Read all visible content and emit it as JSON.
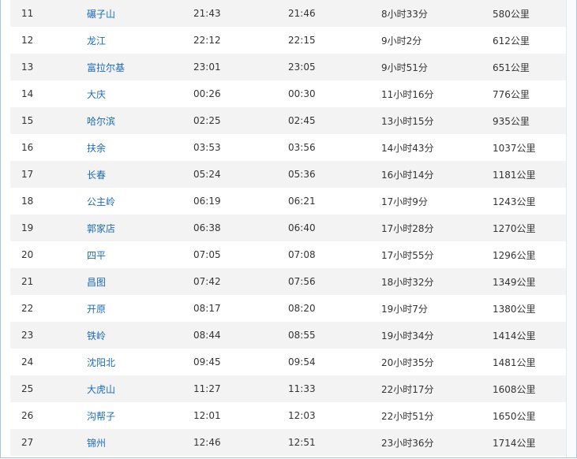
{
  "timetable": {
    "rows": [
      {
        "no": "11",
        "station": "碾子山",
        "arrive": "21:43",
        "depart": "21:46",
        "duration": "8小时33分",
        "distance": "580公里"
      },
      {
        "no": "12",
        "station": "龙江",
        "arrive": "22:12",
        "depart": "22:15",
        "duration": "9小时2分",
        "distance": "612公里"
      },
      {
        "no": "13",
        "station": "富拉尔基",
        "arrive": "23:01",
        "depart": "23:05",
        "duration": "9小时51分",
        "distance": "651公里"
      },
      {
        "no": "14",
        "station": "大庆",
        "arrive": "00:26",
        "depart": "00:30",
        "duration": "11小时16分",
        "distance": "776公里"
      },
      {
        "no": "15",
        "station": "哈尔滨",
        "arrive": "02:25",
        "depart": "02:45",
        "duration": "13小时15分",
        "distance": "935公里"
      },
      {
        "no": "16",
        "station": "扶余",
        "arrive": "03:53",
        "depart": "03:56",
        "duration": "14小时43分",
        "distance": "1037公里"
      },
      {
        "no": "17",
        "station": "长春",
        "arrive": "05:24",
        "depart": "05:36",
        "duration": "16小时14分",
        "distance": "1181公里"
      },
      {
        "no": "18",
        "station": "公主岭",
        "arrive": "06:19",
        "depart": "06:21",
        "duration": "17小时9分",
        "distance": "1243公里"
      },
      {
        "no": "19",
        "station": "郭家店",
        "arrive": "06:38",
        "depart": "06:40",
        "duration": "17小时28分",
        "distance": "1270公里"
      },
      {
        "no": "20",
        "station": "四平",
        "arrive": "07:05",
        "depart": "07:08",
        "duration": "17小时55分",
        "distance": "1296公里"
      },
      {
        "no": "21",
        "station": "昌图",
        "arrive": "07:42",
        "depart": "07:56",
        "duration": "18小时32分",
        "distance": "1349公里"
      },
      {
        "no": "22",
        "station": "开原",
        "arrive": "08:17",
        "depart": "08:20",
        "duration": "19小时7分",
        "distance": "1380公里"
      },
      {
        "no": "23",
        "station": "铁岭",
        "arrive": "08:44",
        "depart": "08:55",
        "duration": "19小时34分",
        "distance": "1414公里"
      },
      {
        "no": "24",
        "station": "沈阳北",
        "arrive": "09:45",
        "depart": "09:54",
        "duration": "20小时35分",
        "distance": "1481公里"
      },
      {
        "no": "25",
        "station": "大虎山",
        "arrive": "11:27",
        "depart": "11:33",
        "duration": "22小时17分",
        "distance": "1608公里"
      },
      {
        "no": "26",
        "station": "沟帮子",
        "arrive": "12:01",
        "depart": "12:03",
        "duration": "22小时51分",
        "distance": "1650公里"
      },
      {
        "no": "27",
        "station": "锦州",
        "arrive": "12:46",
        "depart": "12:51",
        "duration": "23小时36分",
        "distance": "1714公里"
      }
    ]
  },
  "colors": {
    "link": "#1b6bb8",
    "row_alt": "#f3f3f3",
    "row_plain": "#ffffff",
    "border": "#a9c4df",
    "text": "#333333"
  }
}
